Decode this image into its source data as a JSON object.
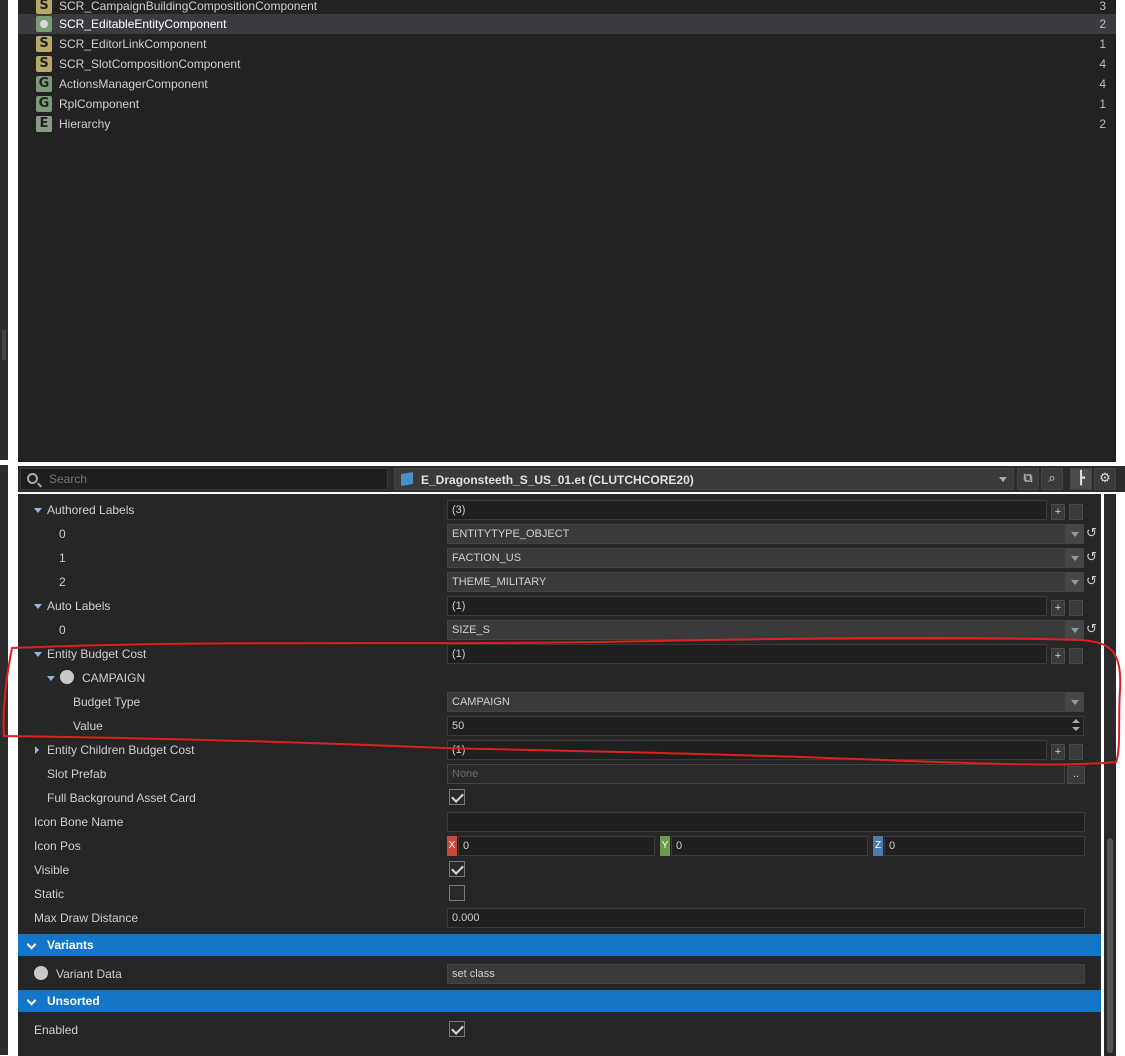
{
  "component_list": [
    {
      "badge": "S",
      "name": "SCR_CampaignBuildingCompositionComponent",
      "count": "3"
    },
    {
      "badge": "O",
      "name": "SCR_EditableEntityComponent",
      "count": "2"
    },
    {
      "badge": "S",
      "name": "SCR_EditorLinkComponent",
      "count": "1"
    },
    {
      "badge": "S",
      "name": "SCR_SlotCompositionComponent",
      "count": "4"
    },
    {
      "badge": "G",
      "name": "ActionsManagerComponent",
      "count": "4"
    },
    {
      "badge": "G",
      "name": "RplComponent",
      "count": "1"
    },
    {
      "badge": "E",
      "name": "Hierarchy",
      "count": "2"
    }
  ],
  "toolbar": {
    "search_placeholder": "Search",
    "entity_label": "E_Dragonsteeth_S_US_01.et (CLUTCHCORE20)",
    "open_icon": "external-link-icon",
    "search_icon": "search-icon",
    "hierarchy_icon": "hierarchy-icon",
    "settings_icon": "gear-icon"
  },
  "properties": {
    "authored_labels": {
      "label": "Authored Labels",
      "value": "(3)"
    },
    "authored_items": [
      {
        "index": "0",
        "value": "ENTITYTYPE_OBJECT"
      },
      {
        "index": "1",
        "value": "FACTION_US"
      },
      {
        "index": "2",
        "value": "THEME_MILITARY"
      }
    ],
    "auto_labels": {
      "label": "Auto Labels",
      "value": "(1)"
    },
    "auto_items": [
      {
        "index": "0",
        "value": "SIZE_S"
      }
    ],
    "entity_budget_cost": {
      "label": "Entity Budget Cost",
      "value": "(1)"
    },
    "campaign_node": {
      "label": "CAMPAIGN"
    },
    "budget_type": {
      "label": "Budget Type",
      "value": "CAMPAIGN"
    },
    "value_field": {
      "label": "Value",
      "value": "50"
    },
    "entity_children_budget_cost": {
      "label": "Entity Children Budget Cost",
      "value": "(1)"
    },
    "slot_prefab": {
      "label": "Slot Prefab",
      "value": "None",
      "button": ".."
    },
    "full_background": {
      "label": "Full Background Asset Card",
      "checked": true
    },
    "icon_bone_name": {
      "label": "Icon Bone Name",
      "value": ""
    },
    "icon_pos": {
      "label": "Icon Pos",
      "x_tag": "X",
      "y_tag": "Y",
      "z_tag": "Z",
      "x": "0",
      "y": "0",
      "z": "0"
    },
    "visible": {
      "label": "Visible",
      "checked": true
    },
    "static": {
      "label": "Static",
      "checked": false
    },
    "max_draw_distance": {
      "label": "Max Draw Distance",
      "value": "0.000"
    }
  },
  "sections": {
    "variants": {
      "title": "Variants"
    },
    "variant_data": {
      "label": "Variant Data",
      "value": "set class"
    },
    "unsorted": {
      "title": "Unsorted"
    },
    "enabled": {
      "label": "Enabled",
      "checked": true
    }
  },
  "buttons": {
    "plus": "+",
    "reset": "↺"
  },
  "colors": {
    "accent": "#1376c8",
    "annotation": "#e02020",
    "badge_s": "#b7a86a",
    "badge_g": "#7d9a7a",
    "tag_x": "#c8483a",
    "tag_y": "#6a9a4a",
    "tag_z": "#4a7ab0"
  }
}
